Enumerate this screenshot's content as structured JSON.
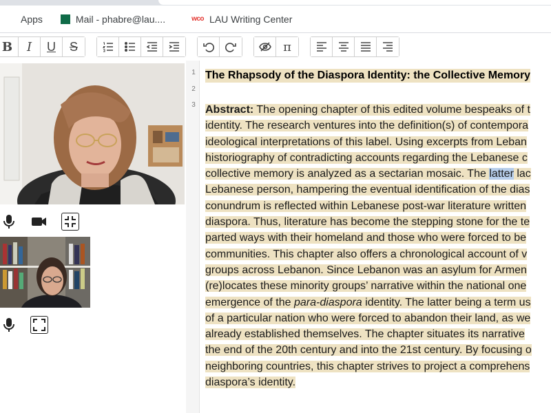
{
  "bookmarks": [
    {
      "label": "Apps",
      "icon": "apps-grid-icon"
    },
    {
      "label": "Mail - phabre@lau....",
      "icon": "mail-icon"
    },
    {
      "label": "LAU Writing Center",
      "icon": "wco-icon",
      "icon_text": "wco"
    }
  ],
  "toolbar": {
    "bold": "B",
    "italic": "I",
    "underline": "U",
    "strikethrough": "S",
    "pi": "π"
  },
  "line_numbers": [
    "1",
    "2",
    "3"
  ],
  "document": {
    "title": "The Rhapsody of the Diaspora Identity: the Collective Memory",
    "abstract_label": "Abstract:",
    "lines": [
      " The opening chapter of this edited volume bespeaks of t",
      "identity. The research ventures into the definition(s) of contempora",
      "ideological interpretations of this label. Using excerpts from Leban",
      "historiography of contradicting accounts regarding the Lebanese c",
      "collective memory is analyzed as a sectarian mosaic. The ",
      "Lebanese person, hampering the eventual identification of the dias",
      "conundrum is reflected within Lebanese post-war literature written",
      "diaspora. Thus, literature has become the stepping stone for the te",
      "parted ways with their homeland and those who were forced to be",
      "communities. This chapter also offers a chronological account of v",
      "groups across Lebanon. Since Lebanon was an asylum for Armen",
      "(re)locates these minority groups’ narrative within the national one",
      "emergence of the ",
      "of a particular nation who were forced to abandon their land, as we",
      "already established themselves. The chapter situates its narrative",
      "the end of the 20th century and into the 21st century. By focusing o",
      "neighboring countries, this chapter strives to project a comprehens",
      "diaspora’s identity."
    ],
    "selected_word": "latter",
    "after_selected": " lac",
    "italic_term": "para-diaspora",
    "after_italic": " identity. The latter being a term us"
  },
  "colors": {
    "highlight": "#eee2c2",
    "selection": "#b6cdea",
    "mail_icon": "#0f6b48",
    "wco_icon": "#e3342f"
  }
}
